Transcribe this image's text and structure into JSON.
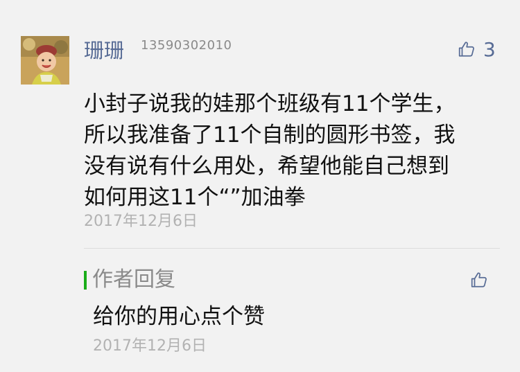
{
  "comment": {
    "username": "珊珊",
    "user_id": "13590302010",
    "like_count": "3",
    "like_icon": "thumbs-up-icon",
    "body_lines": [
      "小封子说我的娃那个班级有11个学生，",
      "所以我准备了11个自制的圆形书签，我",
      "没有说有什么用处，希望他能自己想到",
      "如何用这11个“”加油拳"
    ],
    "date": "2017年12月6日"
  },
  "author_reply": {
    "label": "作者回复",
    "like_icon": "thumbs-up-icon",
    "body": "给你的用心点个赞",
    "date": "2017年12月6日"
  },
  "colors": {
    "link_blue": "#576b95",
    "reply_bar_green": "#1aad19",
    "meta_gray": "#b2b2b2",
    "text_black": "#111111",
    "background": "#f2f2f2"
  }
}
